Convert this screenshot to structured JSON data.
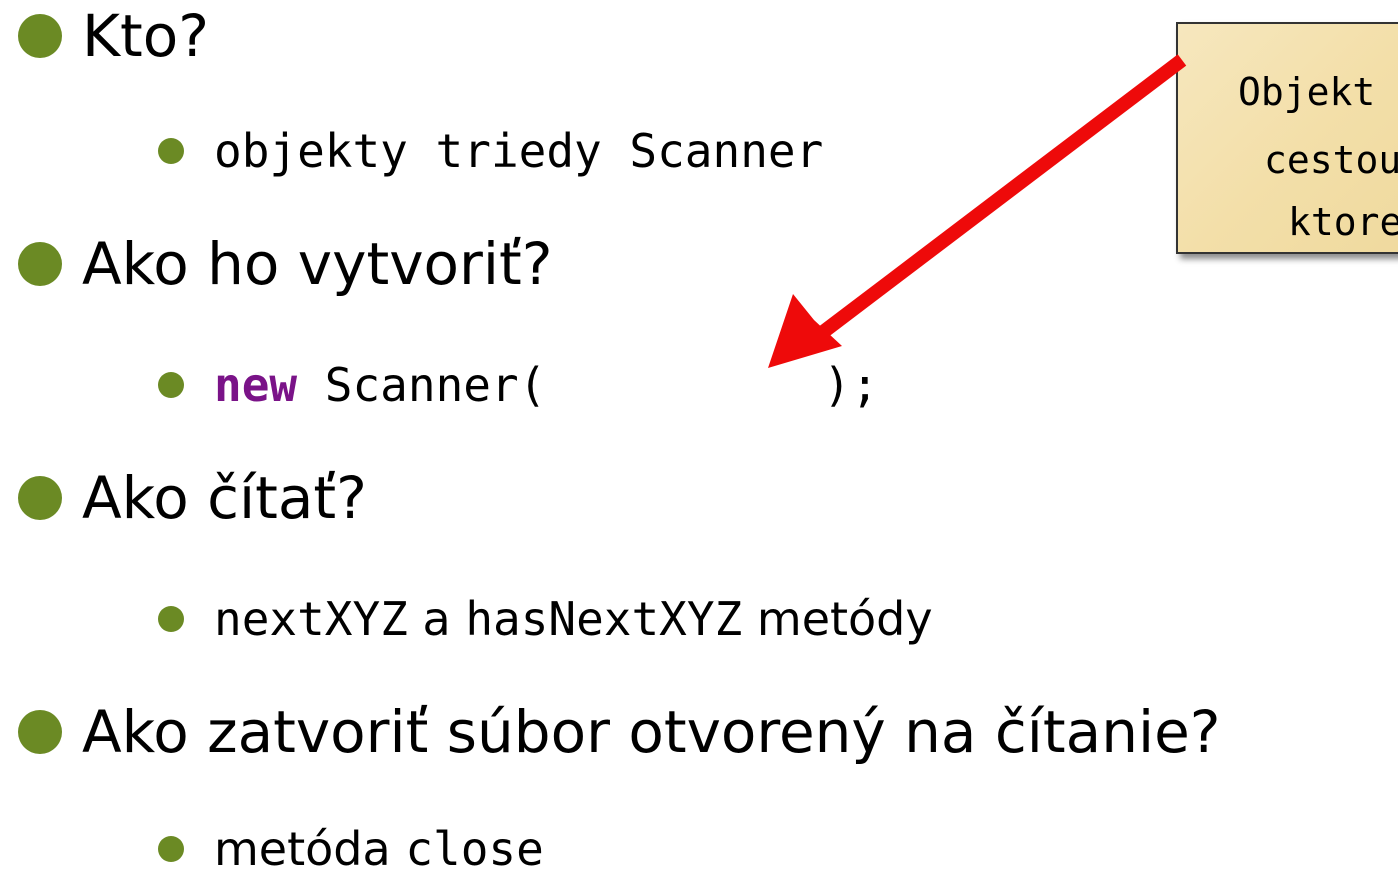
{
  "colors": {
    "bullet": "#6b8a24",
    "keyword": "#7a1388",
    "arrow": "#ee0a0a",
    "callout_bg": "#f3dfa9"
  },
  "bullets": [
    {
      "text": "Kto?"
    },
    {
      "pre": "",
      "code": "",
      "text": "objekty triedy ",
      "code2": "Scanner"
    },
    {
      "text": "Ako ho vytvoriť?"
    },
    {
      "keyword": "new",
      "code": " Scanner(          );"
    },
    {
      "text": "Ako čítať?"
    },
    {
      "code": "nextXYZ",
      "mid": " a ",
      "code2": "hasNextXYZ",
      "text": " metódy"
    },
    {
      "text": "Ako zatvoriť súbor otvorený na čítanie?"
    },
    {
      "text": "metóda ",
      "code": "close"
    }
  ],
  "callout": {
    "line1": "Objekt",
    "line2": "cestou",
    "line3": "ktore"
  },
  "arrow_icon": "arrow-icon"
}
